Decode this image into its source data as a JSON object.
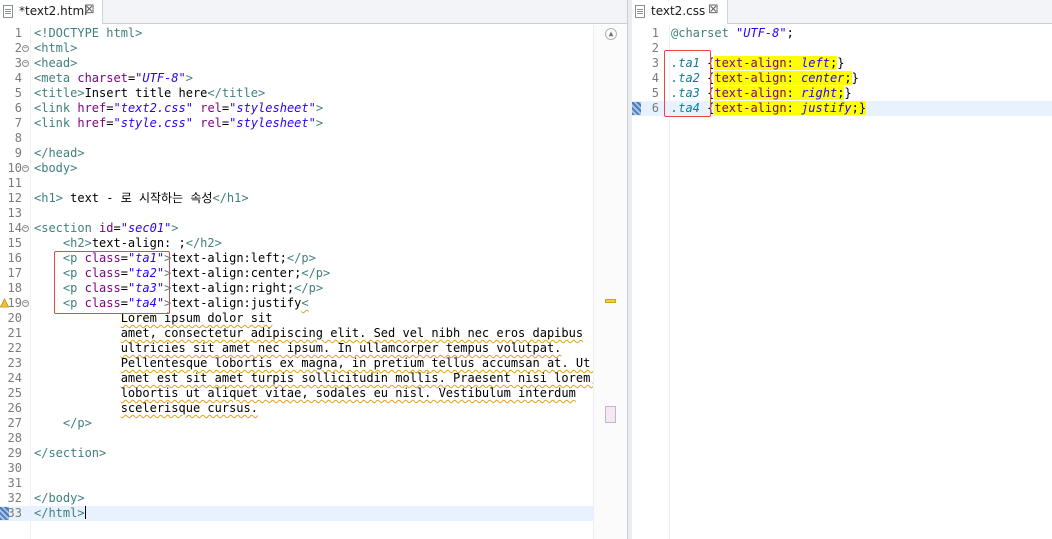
{
  "html_editor": {
    "tab_title": "*text2.html",
    "tab_close_icon": "close-icon",
    "lines": [
      {
        "n": "1",
        "fold": false,
        "marker": null,
        "current": false,
        "tokens": [
          {
            "c": "t-doc",
            "t": "<!DOCTYPE html>"
          }
        ]
      },
      {
        "n": "2",
        "fold": true,
        "marker": null,
        "current": false,
        "tokens": [
          {
            "c": "t-tag",
            "t": "<html>"
          }
        ]
      },
      {
        "n": "3",
        "fold": true,
        "marker": null,
        "current": false,
        "tokens": [
          {
            "c": "t-tag",
            "t": "<head>"
          }
        ]
      },
      {
        "n": "4",
        "fold": false,
        "marker": null,
        "current": false,
        "tokens": [
          {
            "c": "t-tag",
            "t": "<meta "
          },
          {
            "c": "t-attr",
            "t": "charset"
          },
          {
            "c": "t-text",
            "t": "="
          },
          {
            "c": "t-val",
            "t": "\"UTF-8\""
          },
          {
            "c": "t-tag",
            "t": ">"
          }
        ]
      },
      {
        "n": "5",
        "fold": false,
        "marker": null,
        "current": false,
        "tokens": [
          {
            "c": "t-tag",
            "t": "<title>"
          },
          {
            "c": "t-text",
            "t": "Insert title here"
          },
          {
            "c": "t-tag",
            "t": "</title>"
          }
        ]
      },
      {
        "n": "6",
        "fold": false,
        "marker": null,
        "current": false,
        "tokens": [
          {
            "c": "t-tag",
            "t": "<link "
          },
          {
            "c": "t-attr",
            "t": "href"
          },
          {
            "c": "t-text",
            "t": "="
          },
          {
            "c": "t-val",
            "t": "\"text2.css\""
          },
          {
            "c": "t-text",
            "t": " "
          },
          {
            "c": "t-attr",
            "t": "rel"
          },
          {
            "c": "t-text",
            "t": "="
          },
          {
            "c": "t-val",
            "t": "\"stylesheet\""
          },
          {
            "c": "t-tag",
            "t": ">"
          }
        ]
      },
      {
        "n": "7",
        "fold": false,
        "marker": null,
        "current": false,
        "tokens": [
          {
            "c": "t-tag",
            "t": "<link "
          },
          {
            "c": "t-attr",
            "t": "href"
          },
          {
            "c": "t-text",
            "t": "="
          },
          {
            "c": "t-val",
            "t": "\"style.css\""
          },
          {
            "c": "t-text",
            "t": " "
          },
          {
            "c": "t-attr",
            "t": "rel"
          },
          {
            "c": "t-text",
            "t": "="
          },
          {
            "c": "t-val",
            "t": "\"stylesheet\""
          },
          {
            "c": "t-tag",
            "t": ">"
          }
        ]
      },
      {
        "n": "8",
        "fold": false,
        "marker": null,
        "current": false,
        "tokens": []
      },
      {
        "n": "9",
        "fold": false,
        "marker": null,
        "current": false,
        "tokens": [
          {
            "c": "t-tag",
            "t": "</head>"
          }
        ]
      },
      {
        "n": "10",
        "fold": true,
        "marker": null,
        "current": false,
        "tokens": [
          {
            "c": "t-tag",
            "t": "<body>"
          }
        ]
      },
      {
        "n": "11",
        "fold": false,
        "marker": null,
        "current": false,
        "tokens": []
      },
      {
        "n": "12",
        "fold": false,
        "marker": null,
        "current": false,
        "tokens": [
          {
            "c": "t-tag",
            "t": "<h1>"
          },
          {
            "c": "t-text",
            "t": " text - 로 시작하는 속성"
          },
          {
            "c": "t-tag",
            "t": "</h1>"
          }
        ]
      },
      {
        "n": "13",
        "fold": false,
        "marker": null,
        "current": false,
        "tokens": []
      },
      {
        "n": "14",
        "fold": true,
        "marker": null,
        "current": false,
        "tokens": [
          {
            "c": "t-tag",
            "t": "<section "
          },
          {
            "c": "t-attr",
            "t": "id"
          },
          {
            "c": "t-text",
            "t": "="
          },
          {
            "c": "t-val",
            "t": "\"sec01\""
          },
          {
            "c": "t-tag",
            "t": ">"
          }
        ]
      },
      {
        "n": "15",
        "fold": false,
        "marker": null,
        "current": false,
        "tokens": [
          {
            "c": "t-text",
            "t": "    "
          },
          {
            "c": "t-tag",
            "t": "<h2>"
          },
          {
            "c": "t-text",
            "t": "text-align: ;"
          },
          {
            "c": "t-tag",
            "t": "</h2>"
          }
        ]
      },
      {
        "n": "16",
        "fold": false,
        "marker": null,
        "current": false,
        "tokens": [
          {
            "c": "t-text",
            "t": "    "
          },
          {
            "c": "t-tag",
            "t": "<p "
          },
          {
            "c": "t-attr",
            "t": "class"
          },
          {
            "c": "t-text",
            "t": "="
          },
          {
            "c": "t-val",
            "t": "\"ta1\""
          },
          {
            "c": "t-tag",
            "t": ">"
          },
          {
            "c": "t-text",
            "t": "text-align:left;"
          },
          {
            "c": "t-tag",
            "t": "</p>"
          }
        ]
      },
      {
        "n": "17",
        "fold": false,
        "marker": null,
        "current": false,
        "tokens": [
          {
            "c": "t-text",
            "t": "    "
          },
          {
            "c": "t-tag",
            "t": "<p "
          },
          {
            "c": "t-attr",
            "t": "class"
          },
          {
            "c": "t-text",
            "t": "="
          },
          {
            "c": "t-val",
            "t": "\"ta2\""
          },
          {
            "c": "t-tag",
            "t": ">"
          },
          {
            "c": "t-text",
            "t": "text-align:center;"
          },
          {
            "c": "t-tag",
            "t": "</p>"
          }
        ]
      },
      {
        "n": "18",
        "fold": false,
        "marker": null,
        "current": false,
        "tokens": [
          {
            "c": "t-text",
            "t": "    "
          },
          {
            "c": "t-tag",
            "t": "<p "
          },
          {
            "c": "t-attr",
            "t": "class"
          },
          {
            "c": "t-text",
            "t": "="
          },
          {
            "c": "t-val",
            "t": "\"ta3\""
          },
          {
            "c": "t-tag",
            "t": ">"
          },
          {
            "c": "t-text",
            "t": "text-align:right;"
          },
          {
            "c": "t-tag",
            "t": "</p>"
          }
        ]
      },
      {
        "n": "19",
        "fold": true,
        "marker": "warning",
        "current": false,
        "tokens": [
          {
            "c": "t-text",
            "t": "    "
          },
          {
            "c": "t-tag",
            "t": "<p "
          },
          {
            "c": "t-attr",
            "t": "class"
          },
          {
            "c": "t-text",
            "t": "="
          },
          {
            "c": "t-val",
            "t": "\"ta4\""
          },
          {
            "c": "t-tag",
            "t": ">"
          },
          {
            "c": "t-text",
            "t": "text-align:justify"
          },
          {
            "c": "t-tag squiggle",
            "t": "<"
          }
        ]
      },
      {
        "n": "20",
        "fold": false,
        "marker": null,
        "current": false,
        "tokens": [
          {
            "c": "t-text",
            "t": "            "
          },
          {
            "c": "t-text squiggle",
            "t": "Lorem ipsum dolor sit"
          }
        ]
      },
      {
        "n": "21",
        "fold": false,
        "marker": null,
        "current": false,
        "tokens": [
          {
            "c": "t-text",
            "t": "            "
          },
          {
            "c": "t-text squiggle",
            "t": "amet, consectetur adipiscing elit. Sed vel nibh nec eros dapibus"
          }
        ]
      },
      {
        "n": "22",
        "fold": false,
        "marker": null,
        "current": false,
        "tokens": [
          {
            "c": "t-text",
            "t": "            "
          },
          {
            "c": "t-text squiggle",
            "t": "ultricies sit amet nec ipsum. In ullamcorper tempus volutpat."
          }
        ]
      },
      {
        "n": "23",
        "fold": false,
        "marker": null,
        "current": false,
        "tokens": [
          {
            "c": "t-text",
            "t": "            "
          },
          {
            "c": "t-text squiggle",
            "t": "Pellentesque lobortis ex magna, in pretium tellus accumsan at. Ut si"
          }
        ]
      },
      {
        "n": "24",
        "fold": false,
        "marker": null,
        "current": false,
        "tokens": [
          {
            "c": "t-text",
            "t": "            "
          },
          {
            "c": "t-text squiggle",
            "t": "amet est sit amet turpis sollicitudin mollis. Praesent nisi lorem,"
          }
        ]
      },
      {
        "n": "25",
        "fold": false,
        "marker": null,
        "current": false,
        "tokens": [
          {
            "c": "t-text",
            "t": "            "
          },
          {
            "c": "t-text squiggle",
            "t": "lobortis ut aliquet vitae, sodales eu nisl. Vestibulum interdum"
          }
        ]
      },
      {
        "n": "26",
        "fold": false,
        "marker": null,
        "current": false,
        "tokens": [
          {
            "c": "t-text",
            "t": "            "
          },
          {
            "c": "t-text squiggle",
            "t": "scelerisque cursus."
          }
        ]
      },
      {
        "n": "27",
        "fold": false,
        "marker": null,
        "current": false,
        "tokens": [
          {
            "c": "t-text",
            "t": "    "
          },
          {
            "c": "t-tag",
            "t": "</p>"
          }
        ]
      },
      {
        "n": "28",
        "fold": false,
        "marker": null,
        "current": false,
        "tokens": []
      },
      {
        "n": "29",
        "fold": false,
        "marker": null,
        "current": false,
        "tokens": [
          {
            "c": "t-tag",
            "t": "</section>"
          }
        ]
      },
      {
        "n": "30",
        "fold": false,
        "marker": null,
        "current": false,
        "tokens": []
      },
      {
        "n": "31",
        "fold": false,
        "marker": null,
        "current": false,
        "tokens": []
      },
      {
        "n": "32",
        "fold": false,
        "marker": null,
        "current": false,
        "tokens": [
          {
            "c": "t-tag",
            "t": "</body>"
          }
        ]
      },
      {
        "n": "33",
        "fold": false,
        "marker": "bookmark",
        "current": true,
        "tokens": [
          {
            "c": "t-tag",
            "t": "</html>"
          }
        ]
      }
    ]
  },
  "css_editor": {
    "tab_title": "text2.css",
    "tab_close_icon": "close-icon",
    "lines": [
      {
        "n": "1",
        "marker": null,
        "current": false,
        "tokens": [
          {
            "c": "c-at",
            "t": "@charset "
          },
          {
            "c": "c-str",
            "t": "\"UTF-8\""
          },
          {
            "c": "t-text",
            "t": ";"
          }
        ]
      },
      {
        "n": "2",
        "marker": null,
        "current": false,
        "tokens": []
      },
      {
        "n": "3",
        "marker": null,
        "current": false,
        "tokens": [
          {
            "c": "c-sel",
            "t": ".ta1"
          },
          {
            "c": "t-text",
            "t": " {"
          },
          {
            "c": "c-prop c-hl",
            "t": "text-align"
          },
          {
            "c": "t-text c-hl",
            "t": ": "
          },
          {
            "c": "c-value c-hl",
            "t": "left"
          },
          {
            "c": "t-text c-hl",
            "t": ";"
          },
          {
            "c": "t-text",
            "t": "}"
          }
        ]
      },
      {
        "n": "4",
        "marker": null,
        "current": false,
        "tokens": [
          {
            "c": "c-sel",
            "t": ".ta2"
          },
          {
            "c": "t-text",
            "t": " {"
          },
          {
            "c": "c-prop c-hl",
            "t": "text-align"
          },
          {
            "c": "t-text c-hl",
            "t": ": "
          },
          {
            "c": "c-value c-hl",
            "t": "center"
          },
          {
            "c": "t-text c-hl",
            "t": ";"
          },
          {
            "c": "t-text",
            "t": "}"
          }
        ]
      },
      {
        "n": "5",
        "marker": null,
        "current": false,
        "tokens": [
          {
            "c": "c-sel",
            "t": ".ta3"
          },
          {
            "c": "t-text",
            "t": " {"
          },
          {
            "c": "c-prop c-hl",
            "t": "text-align"
          },
          {
            "c": "t-text c-hl",
            "t": ": "
          },
          {
            "c": "c-value c-hl",
            "t": "right"
          },
          {
            "c": "t-text c-hl",
            "t": ";"
          },
          {
            "c": "t-text",
            "t": "}"
          }
        ]
      },
      {
        "n": "6",
        "marker": "bookmark",
        "current": true,
        "tokens": [
          {
            "c": "c-sel",
            "t": ".ta4"
          },
          {
            "c": "t-text",
            "t": " {"
          },
          {
            "c": "c-prop c-hl",
            "t": "text-align"
          },
          {
            "c": "t-text c-hl",
            "t": ": "
          },
          {
            "c": "c-value c-hl",
            "t": "justify"
          },
          {
            "c": "t-text c-hl",
            "t": ";}"
          }
        ]
      }
    ]
  }
}
